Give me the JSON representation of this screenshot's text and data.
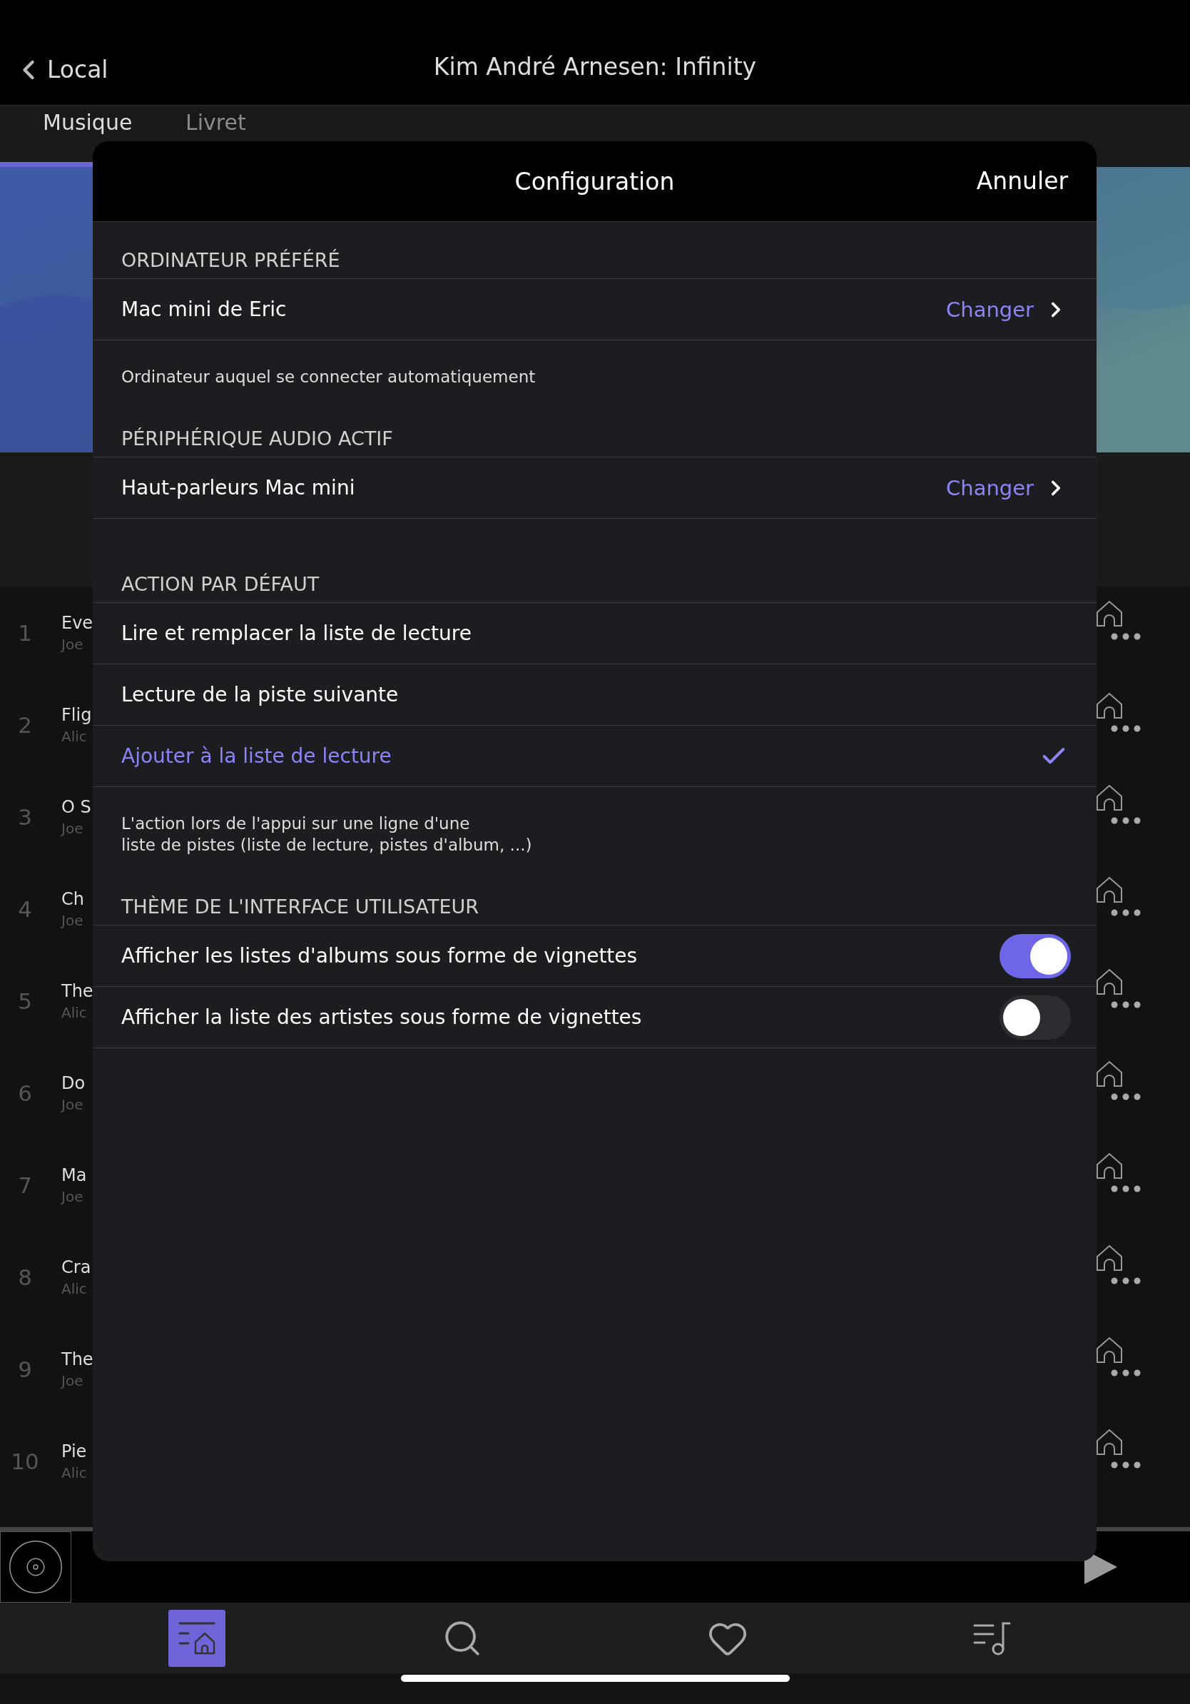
{
  "nav": {
    "back": "Local",
    "title": "Kim André Arnesen: Infinity"
  },
  "tabs": [
    {
      "label": "Musique",
      "selected": true
    },
    {
      "label": "Livret",
      "selected": false
    }
  ],
  "tracks": [
    {
      "number": "1",
      "title": "Eve",
      "artist": "Joe"
    },
    {
      "number": "2",
      "title": "Flig",
      "artist": "Alic"
    },
    {
      "number": "3",
      "title": "O S",
      "artist": "Joe"
    },
    {
      "number": "4",
      "title": "Ch",
      "artist": "Joe"
    },
    {
      "number": "5",
      "title": "The",
      "artist": "Alic"
    },
    {
      "number": "6",
      "title": "Do",
      "artist": "Joe"
    },
    {
      "number": "7",
      "title": "Ma",
      "artist": "Joe"
    },
    {
      "number": "8",
      "title": "Cra",
      "artist": "Alic"
    },
    {
      "number": "9",
      "title": "The",
      "artist": "Joe"
    },
    {
      "number": "10",
      "title": "Pie",
      "artist": "Alic"
    }
  ],
  "dialog": {
    "title": "Configuration",
    "cancel": "Annuler",
    "sections": [
      {
        "header": "ORDINATEUR PRÉFÉRÉ",
        "rows": [
          {
            "kind": "link",
            "label": "Mac mini de Eric",
            "action": "Changer"
          }
        ],
        "footer": "Ordinateur auquel se connecter automatiquement"
      },
      {
        "header": "PÉRIPHÉRIQUE AUDIO ACTIF",
        "rows": [
          {
            "kind": "link",
            "label": "Haut-parleurs Mac mini",
            "action": "Changer"
          }
        ]
      },
      {
        "header": "ACTION PAR DÉFAUT",
        "rows": [
          {
            "kind": "choice",
            "label": "Lire et remplacer la liste de lecture",
            "selected": false
          },
          {
            "kind": "choice",
            "label": "Lecture de la piste suivante",
            "selected": false
          },
          {
            "kind": "choice",
            "label": "Ajouter à la liste de lecture",
            "selected": true
          }
        ],
        "footer": "L'action lors de l'appui sur une ligne d'une\nliste de pistes (liste de lecture, pistes d'album, ...)"
      },
      {
        "header": "THÈME DE L'INTERFACE UTILISATEUR",
        "rows": [
          {
            "kind": "toggle",
            "label": "Afficher les listes d'albums sous forme de vignettes",
            "on": true
          },
          {
            "kind": "toggle",
            "label": "Afficher la liste des artistes sous forme de vignettes",
            "on": false
          }
        ]
      }
    ]
  },
  "bottom_tabs": [
    {
      "kind": "library",
      "selected": true
    },
    {
      "kind": "search",
      "selected": false
    },
    {
      "kind": "favorites",
      "selected": false
    },
    {
      "kind": "queue",
      "selected": false
    }
  ]
}
